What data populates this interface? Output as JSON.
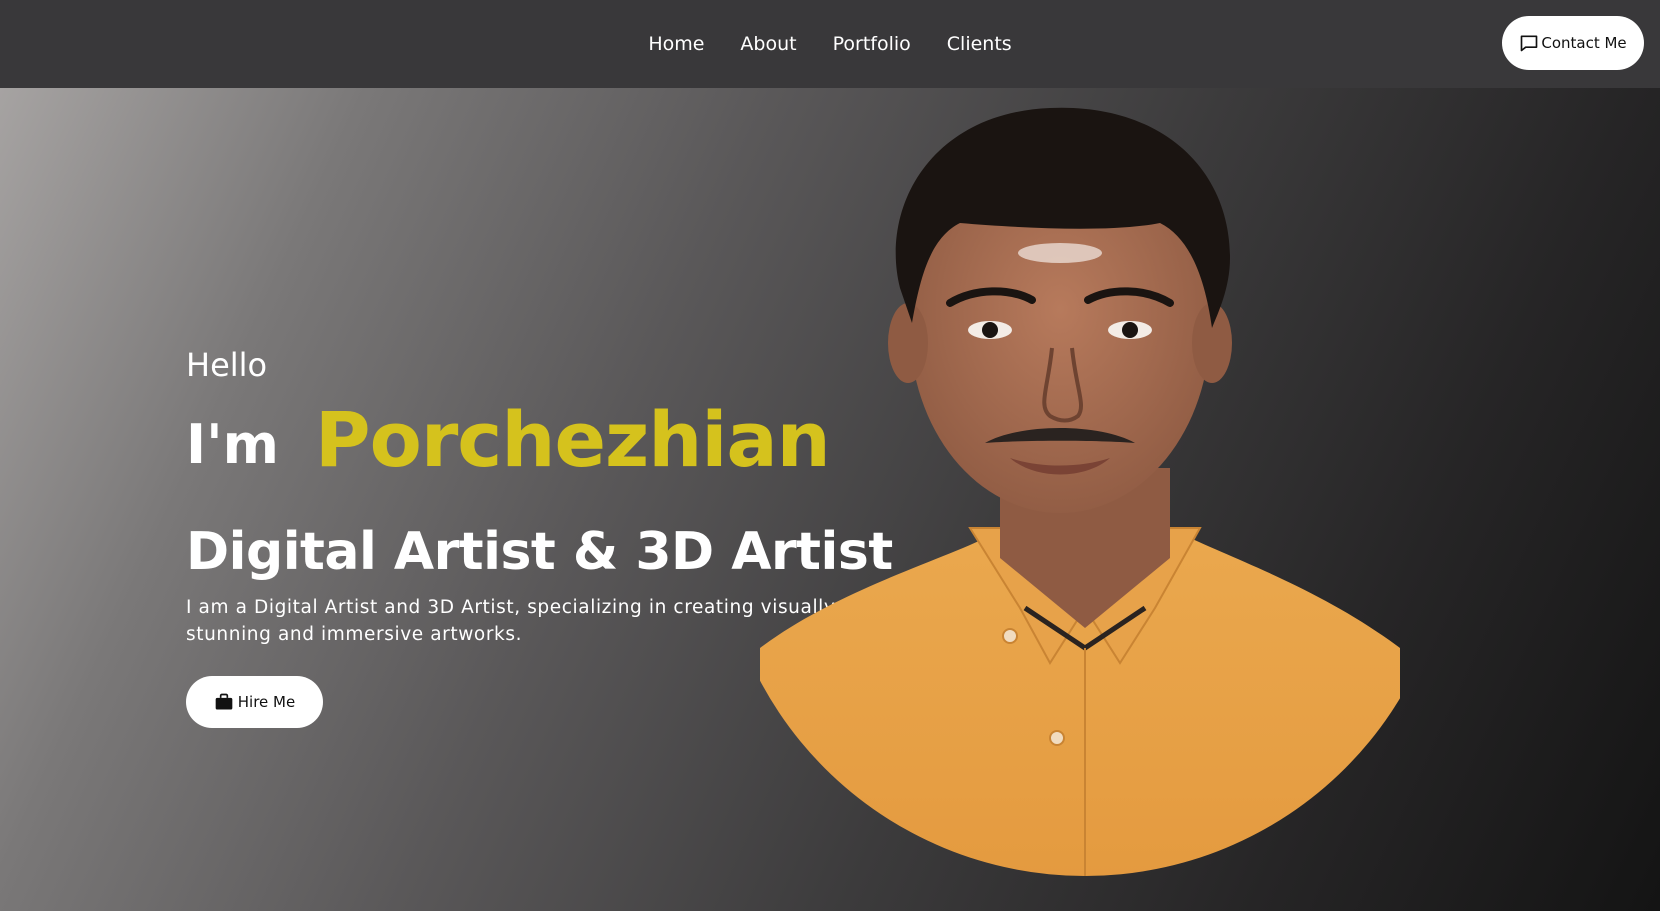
{
  "nav": {
    "links": [
      "Home",
      "About",
      "Portfolio",
      "Clients"
    ],
    "contact_label": "Contact Me",
    "contact_icon": "message-square-icon"
  },
  "hero": {
    "greeting": "Hello",
    "intro": "I'm",
    "name": "Porchezhian",
    "role": "Digital Artist & 3D Artist",
    "description": "I am a Digital Artist and 3D Artist, specializing in creating visually stunning and immersive artworks.",
    "hire_label": "Hire Me",
    "hire_icon": "briefcase-icon",
    "portrait": "profile-photo"
  },
  "colors": {
    "nav_bg": "#39383a",
    "accent": "#d5c21d",
    "shirt": "#e8a24c"
  }
}
